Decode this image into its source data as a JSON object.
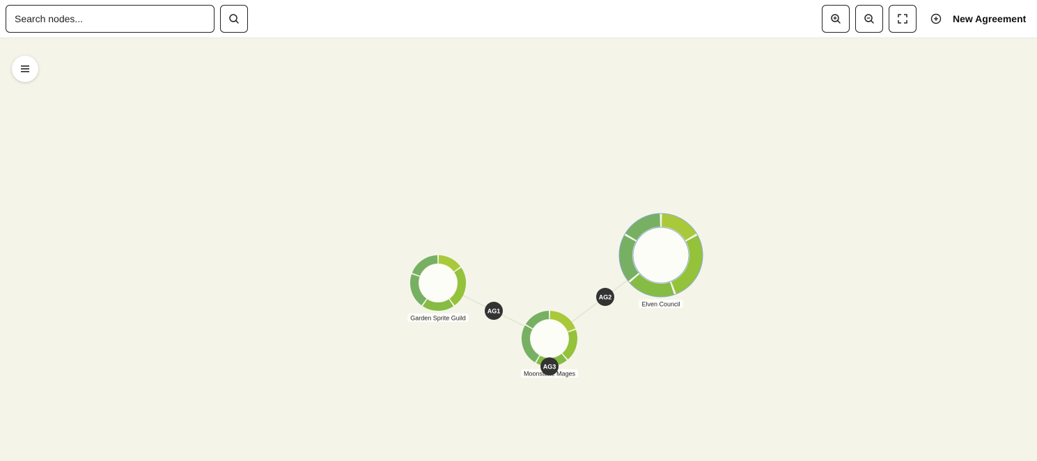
{
  "toolbar": {
    "search_placeholder": "Search nodes...",
    "new_agreement_label": "New Agreement"
  },
  "colors": {
    "canvas_background": "#f4f5e8",
    "segment_a": "#77b063",
    "segment_b": "#a9c93a",
    "segment_c": "#94c23b",
    "segment_d": "#86bb44",
    "node_center": "#fdfdf8",
    "edge": "#e3e5d6",
    "agreement_badge": "#333333",
    "selection_ring": "#8aa9d6"
  },
  "graph": {
    "nodes": [
      {
        "id": "garden",
        "label": "Garden Sprite Guild"
      },
      {
        "id": "moon",
        "label": "Moonstone Mages"
      },
      {
        "id": "elven",
        "label": "Elven Council"
      }
    ],
    "agreements": [
      {
        "id": "AG1",
        "label": "AG1"
      },
      {
        "id": "AG2",
        "label": "AG2"
      },
      {
        "id": "AG3",
        "label": "AG3"
      }
    ]
  }
}
